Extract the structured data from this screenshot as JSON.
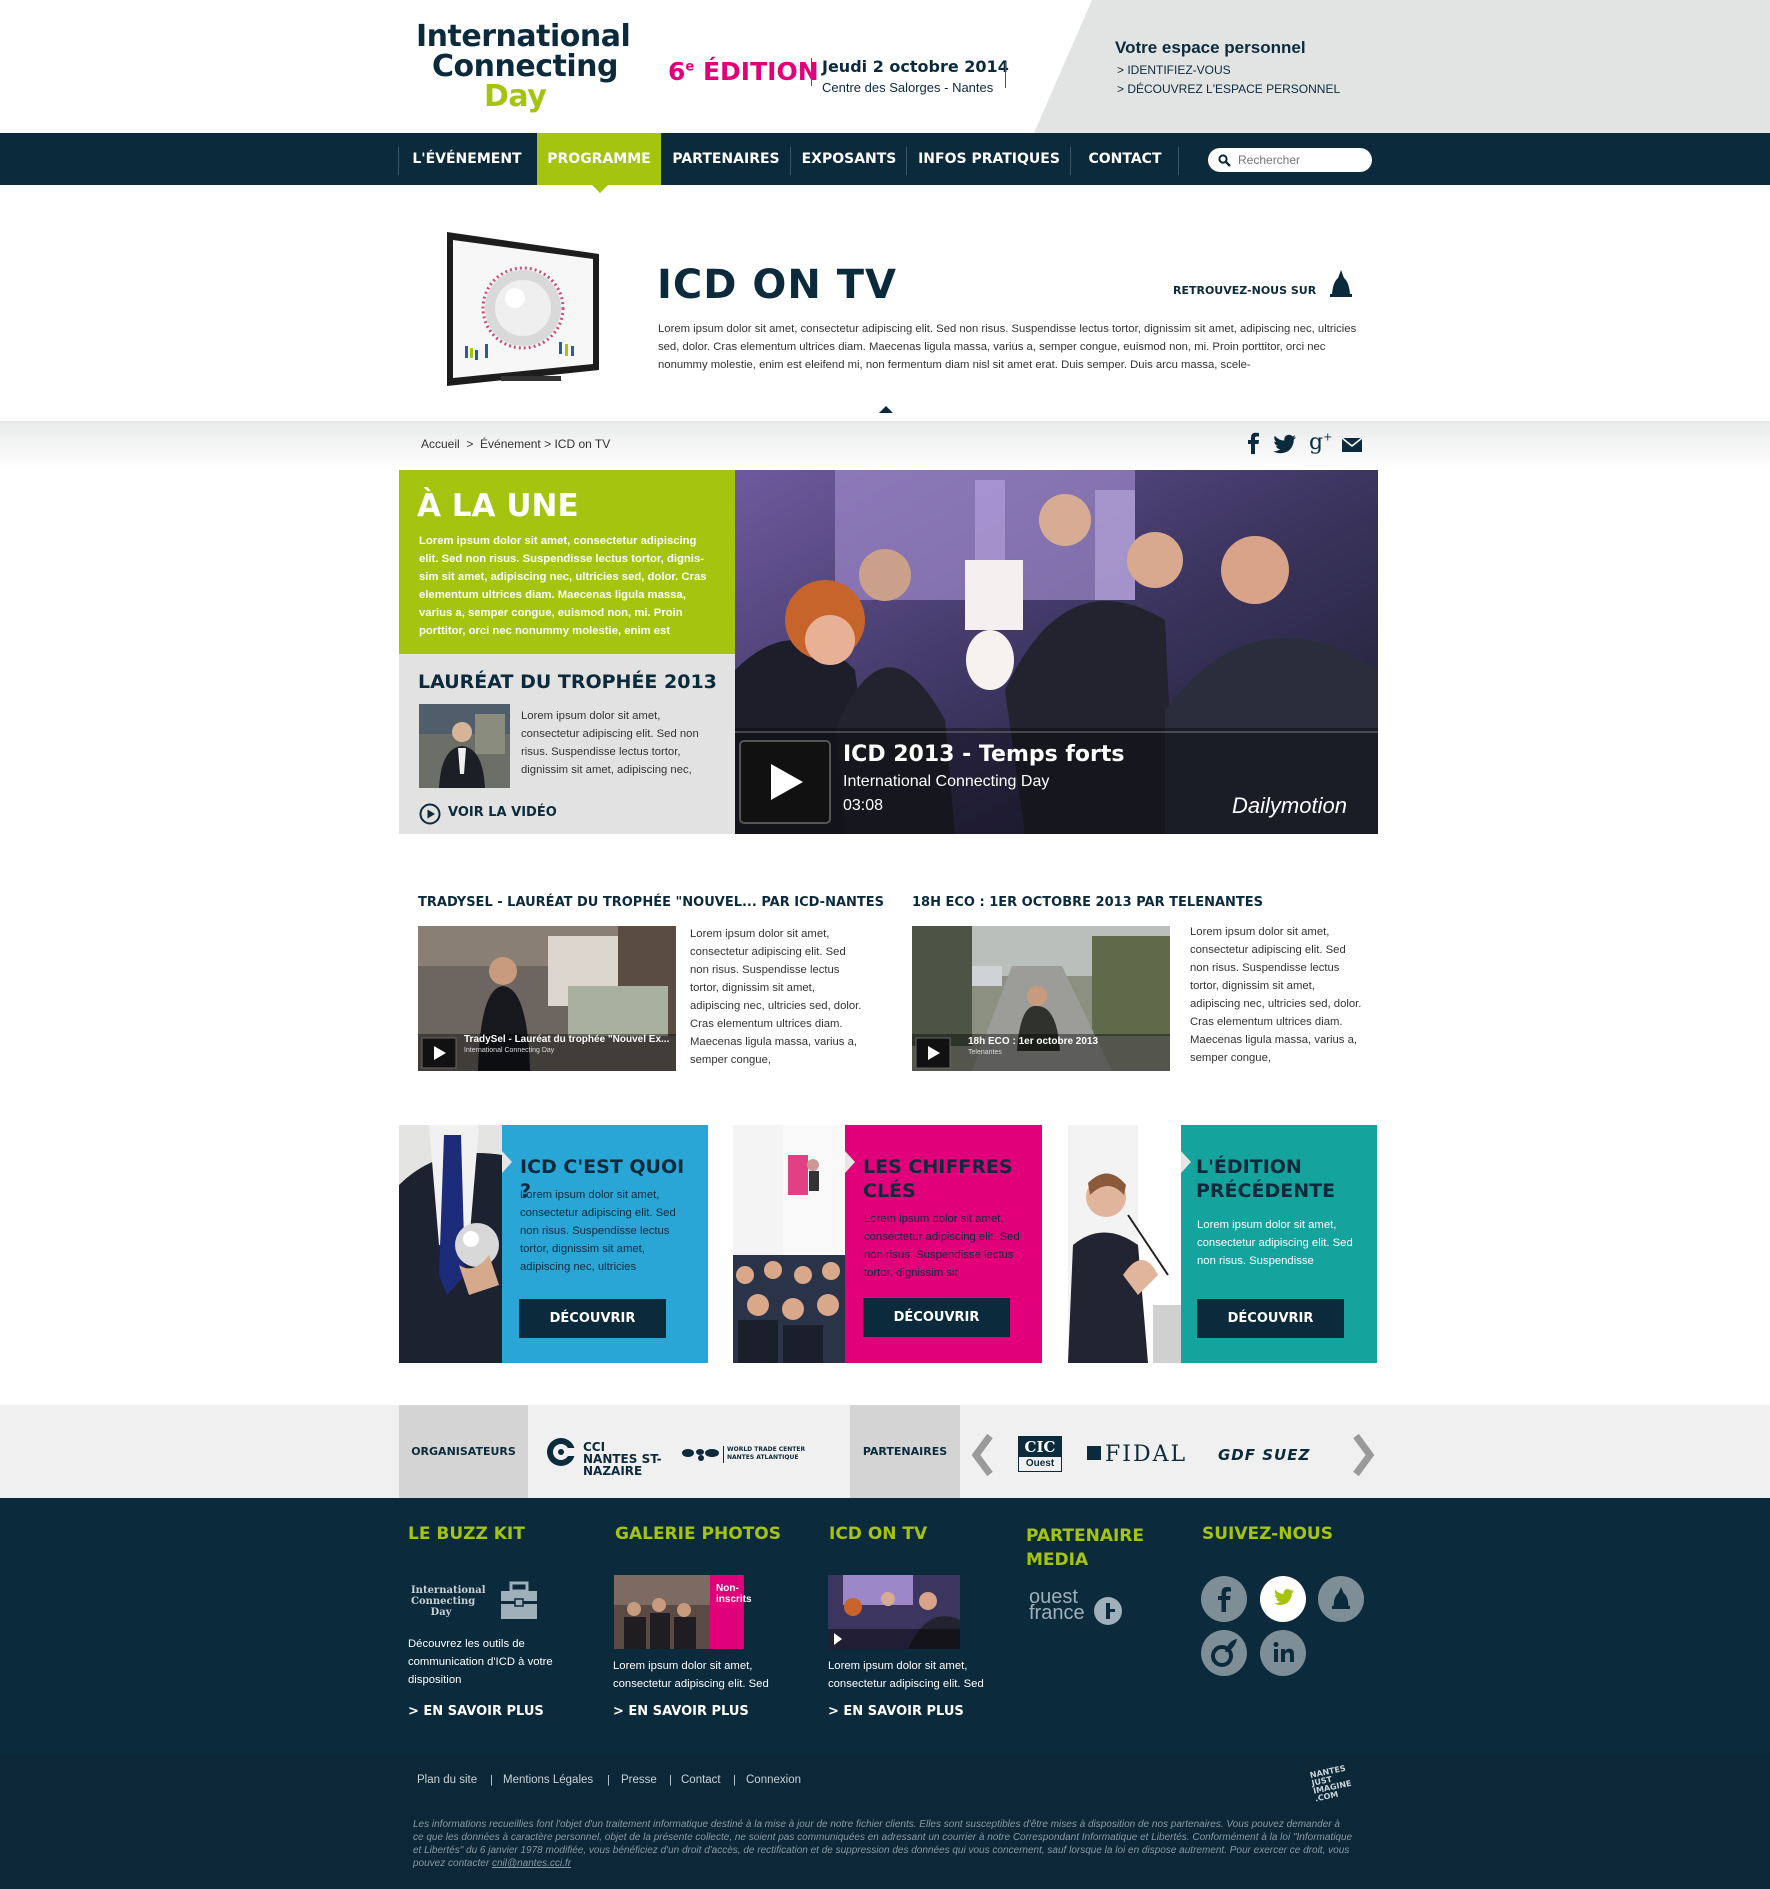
{
  "brand": {
    "logo_line1": "International",
    "logo_line2": "Connecting",
    "logo_line3": "Day",
    "edition_num": "6",
    "edition_sup": "e",
    "edition_label": "ÉDITION",
    "date": "Jeudi 2 octobre 2014",
    "place": "Centre des Salorges - Nantes",
    "colors": {
      "navy": "#0b2a3c",
      "green": "#a4c40f",
      "pink": "#e2007a",
      "blue": "#2aa6d6",
      "teal": "#14a39d"
    }
  },
  "espace": {
    "title": "Votre espace personnel",
    "link1": "> IDENTIFIEZ-VOUS",
    "link2": "> DÉCOUVREZ L'ESPACE PERSONNEL"
  },
  "nav": {
    "items": [
      "L'ÉVÉNEMENT",
      "PROGRAMME",
      "PARTENAIRES",
      "EXPOSANTS",
      "INFOS PRATIQUES",
      "CONTACT"
    ],
    "active": "PROGRAMME",
    "search_placeholder": "Rechercher"
  },
  "hero": {
    "title": "ICD ON TV",
    "retrouvez": "RETROUVEZ-NOUS SUR",
    "text": "Lorem ipsum dolor sit amet, consectetur adipiscing elit. Sed non risus. Suspendisse lectus tortor, dignissim sit amet, adipiscing nec, ultricies sed, dolor. Cras elementum ultrices diam. Maecenas ligula massa, varius a, semper congue, euismod non, mi. Proin porttitor, orci nec nonummy molestie, enim est eleifend mi, non fermentum diam nisl sit amet erat. Duis semper. Duis arcu massa, scele-"
  },
  "breadcrumb": {
    "home": "Accueil",
    "sep1": ">",
    "section": "Événement",
    "sep2": ">",
    "current": "ICD on TV"
  },
  "share_icons": [
    "facebook-icon",
    "twitter-icon",
    "google-plus-icon",
    "mail-icon"
  ],
  "une": {
    "title": "À LA UNE",
    "text": "Lorem ipsum dolor sit amet, consectetur adipiscing elit. Sed non risus. Suspendisse lectus tortor, dignis-sim sit amet, adipiscing nec, ultricies sed, dolor. Cras elementum ultrices diam. Maecenas ligula massa, varius a, semper congue, euismod non, mi. Proin porttitor, orci nec nonummy molestie, enim est",
    "laureat_title": "LAURÉAT DU TROPHÉE 2013",
    "laureat_text": "Lorem ipsum dolor sit amet, consectetur adipiscing elit. Sed non risus. Suspendisse lectus tortor, dignissim sit amet, adipiscing nec,",
    "voir": "VOIR LA VIDÉO"
  },
  "main_video": {
    "title": "ICD 2013 - Temps forts",
    "subtitle": "International Connecting Day",
    "duration": "03:08",
    "provider": "Dailymotion"
  },
  "videos": [
    {
      "title": "TRADYSEL - LAURÉAT DU TROPHÉE \"NOUVEL... PAR ICD-NANTES",
      "text": "Lorem ipsum dolor sit amet, consectetur adipiscing elit. Sed non risus. Suspendisse lectus tortor, dignissim sit amet, adipiscing nec, ultricies sed, dolor. Cras elementum ultrices diam. Maecenas ligula massa, varius a, semper congue,",
      "overlay": "TradySel - Lauréat du trophée \"Nouvel Ex...",
      "overlay_sub": "International Connecting Day"
    },
    {
      "title": "18H ECO : 1ER OCTOBRE 2013 PAR TELENANTES",
      "text": "Lorem ipsum dolor sit amet, consectetur adipiscing elit. Sed non risus. Suspendisse lectus tortor, dignissim sit amet, adipiscing nec, ultricies sed, dolor. Cras elementum ultrices diam. Maecenas ligula massa, varius a, semper congue,",
      "overlay": "18h ECO : 1er octobre 2013",
      "overlay_sub": "Telenantes"
    }
  ],
  "cards": [
    {
      "title": "ICD C'EST QUOI ?",
      "text": "Lorem ipsum dolor sit amet, consectetur adipiscing elit. Sed non risus. Suspendisse lectus tortor, dignissim sit amet, adipiscing nec, ultricies",
      "button": "DÉCOUVRIR"
    },
    {
      "title": "LES CHIFFRES CLÉS",
      "text": "Lorem ipsum dolor sit amet, consectetur adipiscing elit. Sed non risus. Suspendisse lectus tortor, dignissim sit",
      "button": "DÉCOUVRIR"
    },
    {
      "title": "L'ÉDITION PRÉCÉDENTE",
      "text": "Lorem ipsum dolor sit amet, consectetur adipiscing elit. Sed non risus. Suspendisse",
      "button": "DÉCOUVRIR"
    }
  ],
  "sponsors": {
    "organisateurs_label": "ORGANISATEURS",
    "partenaires_label": "PARTENAIRES",
    "cci": "CCI NANTES ST-NAZAIRE",
    "wtc_line1": "WORLD TRADE CENTER",
    "wtc_line2": "NANTES ATLANTIQUE",
    "cic_line1": "CIC",
    "cic_line2": "Ouest",
    "fidal": "FIDAL",
    "gdf": "GDF SUEZ"
  },
  "footer": {
    "buzz_title": "LE BUZZ KIT",
    "buzz_text": "Découvrez les outils de communication d'ICD à votre disposition",
    "galerie_title": "GALERIE PHOTOS",
    "galerie_text": "Lorem ipsum dolor sit amet, consectetur adipiscing elit. Sed",
    "galerie_badge": "Non-inscrits",
    "tv_title": "ICD ON TV",
    "tv_text": "Lorem ipsum dolor sit amet, consectetur adipiscing elit. Sed",
    "media_title": "PARTENAIRE MEDIA",
    "media_logo": "ouest france",
    "suivez_title": "SUIVEZ-NOUS",
    "more": "> EN SAVOIR PLUS"
  },
  "bottom": {
    "links": [
      "Plan du site",
      "Mentions Légales",
      "Presse",
      "Contact",
      "Connexion"
    ],
    "sep": "|",
    "nantes_logo": "NANTES JUST IMAGINE .COM",
    "legal": "Les informations recueillies font l'objet d'un traitement informatique destiné à la mise à jour de notre fichier clients. Elles sont susceptibles d'être mises à disposition de nos partenaires. Vous pouvez demander à ce que les données à caractère personnel, objet de la présente collecte, ne soient pas communiquées en adressant un courrier à notre Correspondant Informatique et Libertés. Conformément à la loi \"Informatique et Libertés\" du 6 janvier 1978 modifiée, vous bénéficiez d'un droit d'accès, de rectification et de suppression des données qui vous concernent, sauf lorsque la loi en dispose autrement. Pour exercer ce droit, vous pouvez contacter",
    "legal_email": "cnil@nantes.cci.fr"
  }
}
